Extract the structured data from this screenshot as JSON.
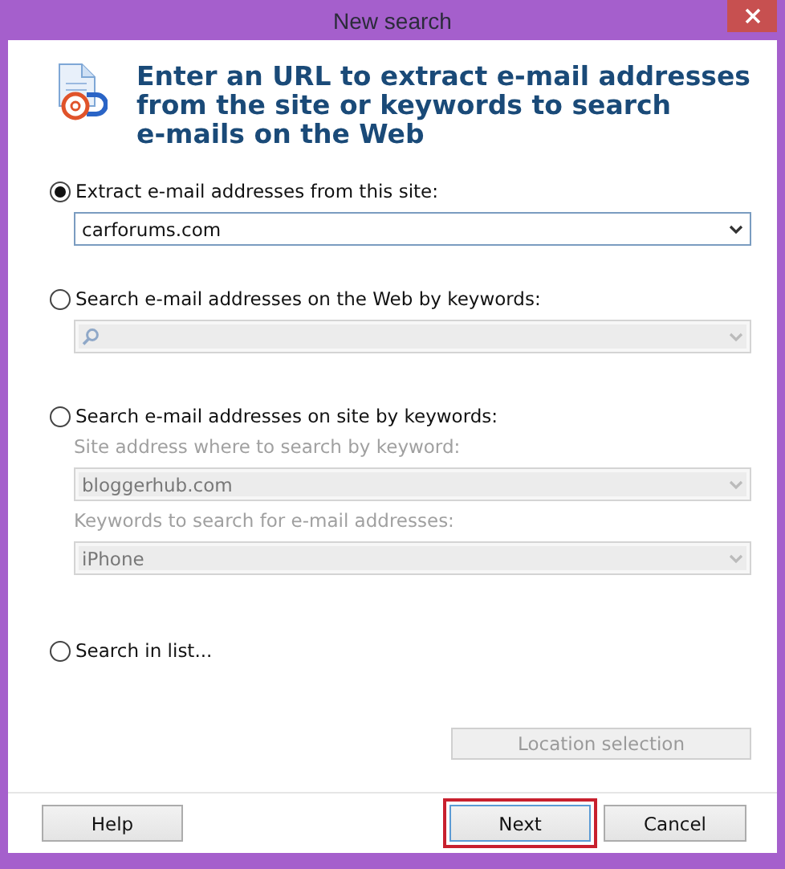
{
  "window": {
    "title": "New search"
  },
  "heading_lines": [
    "Enter an URL to extract e-mail addresses",
    "from the site or keywords to search",
    "e-mails on the Web"
  ],
  "options": [
    {
      "label": "Extract e-mail addresses from this site:",
      "selected": true,
      "fields": [
        {
          "kind": "combo",
          "value": "carforums.com",
          "disabled": false
        }
      ]
    },
    {
      "label": "Search e-mail addresses on the Web by keywords:",
      "selected": false,
      "fields": [
        {
          "kind": "search",
          "disabled": true
        }
      ]
    },
    {
      "label": "Search e-mail addresses on site by keywords:",
      "selected": false,
      "fields": [
        {
          "kind": "combo",
          "caption": "Site address where to search by keyword:",
          "value": "bloggerhub.com",
          "disabled": true
        },
        {
          "kind": "combo",
          "caption": "Keywords to search for e-mail addresses:",
          "value": "iPhone",
          "disabled": true
        }
      ]
    },
    {
      "label": "Search in list...",
      "selected": false
    }
  ],
  "location_button": {
    "label": "Location selection",
    "disabled": true
  },
  "buttons": [
    {
      "label": "Help",
      "focused": false,
      "highlighted": false
    },
    {
      "label": "Next",
      "focused": true,
      "highlighted": true
    },
    {
      "label": "Cancel",
      "focused": false,
      "highlighted": false
    }
  ]
}
